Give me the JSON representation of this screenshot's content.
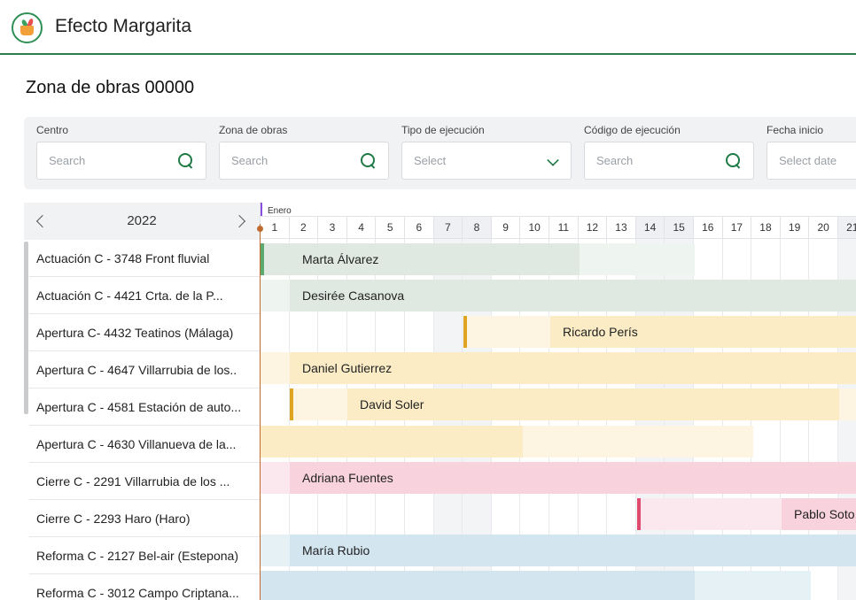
{
  "header": {
    "app_title": "Efecto Margarita",
    "logo_icon": "basket-logo-icon"
  },
  "page": {
    "title": "Zona de obras 00000"
  },
  "filters": [
    {
      "label": "Centro",
      "placeholder": "Search",
      "icon": "search-icon"
    },
    {
      "label": "Zona de obras",
      "placeholder": "Search",
      "icon": "search-icon"
    },
    {
      "label": "Tipo de ejecución",
      "placeholder": "Select",
      "icon": "chevron-down-icon"
    },
    {
      "label": "Código de ejecución",
      "placeholder": "Search",
      "icon": "search-icon"
    },
    {
      "label": "Fecha inicio",
      "placeholder": "Select date",
      "icon": ""
    }
  ],
  "calendar": {
    "year": "2022",
    "month": "Enero",
    "days": [
      "1",
      "2",
      "3",
      "4",
      "5",
      "6",
      "7",
      "8",
      "9",
      "10",
      "11",
      "12",
      "13",
      "14",
      "15",
      "16",
      "17",
      "18",
      "19",
      "20",
      "21"
    ],
    "weekend_days": [
      "7",
      "8",
      "14",
      "15",
      "21"
    ]
  },
  "rows": [
    "Actuación C - 3748 Front fluvial",
    "Actuación C - 4421 Crta. de la P...",
    "Apertura C- 4432 Teatinos (Málaga)",
    "Apertura C - 4647 Villarrubia de los..",
    "Apertura C - 4581 Estación de auto...",
    "Apertura C - 4630 Villanueva de la...",
    "Cierre C - 2291 Villarrubia de los ...",
    "Cierre C - 2293 Haro (Haro)",
    "Reforma C - 2127 Bel-air (Estepona)",
    "Reforma C - 3012 Campo Criptana..."
  ],
  "bars": [
    {
      "person": "Marta Álvarez",
      "color": "#dfe9e2",
      "light": "#eef4f0",
      "accent": "#5aa96f"
    },
    {
      "person": "Desirée Casanova",
      "color": "#dfe9e2",
      "light": "#eef4f0",
      "accent": ""
    },
    {
      "person": "Ricardo Perís",
      "color": "#fbecc6",
      "light": "#fdf5e1",
      "accent": "#e0a520"
    },
    {
      "person": "Daniel Gutierrez",
      "color": "#fbecc6",
      "light": "#fdf5e1",
      "accent": ""
    },
    {
      "person": "David Soler",
      "color": "#fbecc6",
      "light": "#fdf5e1",
      "accent": "#e0a520"
    },
    {
      "person": "",
      "color": "#fbecc6",
      "light": "#fdf5e1",
      "accent": ""
    },
    {
      "person": "Adriana Fuentes",
      "color": "#f8d3de",
      "light": "#fbe8ee",
      "accent": ""
    },
    {
      "person": "Pablo Soto",
      "color": "#f8d3de",
      "light": "#fbe8ee",
      "accent": "#e04a6e"
    },
    {
      "person": "María Rubio",
      "color": "#d3e6ef",
      "light": "#e6f1f6",
      "accent": ""
    },
    {
      "person": "",
      "color": "#d3e6ef",
      "light": "#e6f1f6",
      "accent": ""
    }
  ],
  "colors": {
    "brand_green": "#2f7d4f",
    "today_line": "#c06a2e",
    "month_marker": "#8a4fe0"
  }
}
